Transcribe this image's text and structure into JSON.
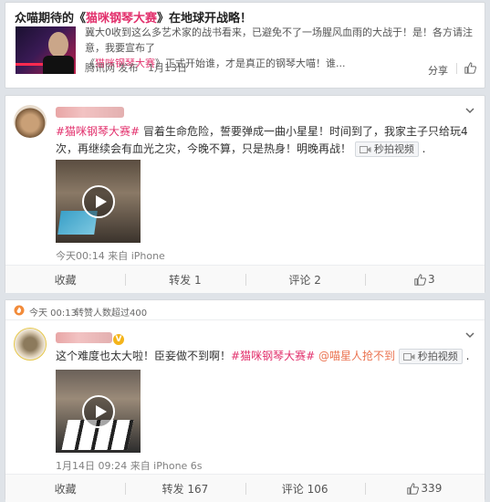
{
  "colors": {
    "hashtag": "#e2306c",
    "mention": "#eb7350",
    "page_bg": "#dfe3e8"
  },
  "card1": {
    "title_prefix": "众喵期待的《",
    "title_tag": "猫咪钢琴大赛",
    "title_suffix": "》在地球开战略！",
    "desc_line1": "冀大0收到这么多艺术家的战书看来，已避免不了一场腥风血雨的大战于！是！各方请注意，我要宣布了",
    "desc_line2_prefix": "《",
    "desc_line2_tag": "猫咪钢琴大赛",
    "desc_line2_suffix": "》正式开始谁，才是真正的钢琴大喵！谁...",
    "source": "腾讯网 发布",
    "date": "1月13日",
    "share_label": "分享"
  },
  "card2": {
    "text_tag": "#猫咪钢琴大赛#",
    "text_body": " 冒着生命危险，誓要弹成一曲小星星！时间到了，我家主子只给玩4次，再继续会有血光之灾，今晚不算，只是热身！明晚再战！",
    "video_chip": "秒拍视频",
    "trailing_dot": ".",
    "time_source": "今天00:14 来自 iPhone",
    "actions": {
      "collect": "收藏",
      "repost": "转发 1",
      "comment": "评论 2",
      "like": "3"
    }
  },
  "card3": {
    "header_time": "今天 00:13",
    "header_text": "转赞人数超过400",
    "text_body": "这个难度也太大啦！臣妾做不到啊！",
    "text_tag": "#猫咪钢琴大赛#",
    "text_mention": " @喵星人抢不到",
    "video_chip": "秒拍视频",
    "trailing_dot": ".",
    "time_source": "1月14日 09:24 来自 iPhone 6s",
    "actions": {
      "collect": "收藏",
      "repost": "转发 167",
      "comment": "评论 106",
      "like": "339"
    }
  },
  "icons": [
    "chevron-down-icon",
    "thumbs-up-icon",
    "play-icon",
    "video-icon",
    "hot-icon",
    "verified-badge-icon"
  ]
}
